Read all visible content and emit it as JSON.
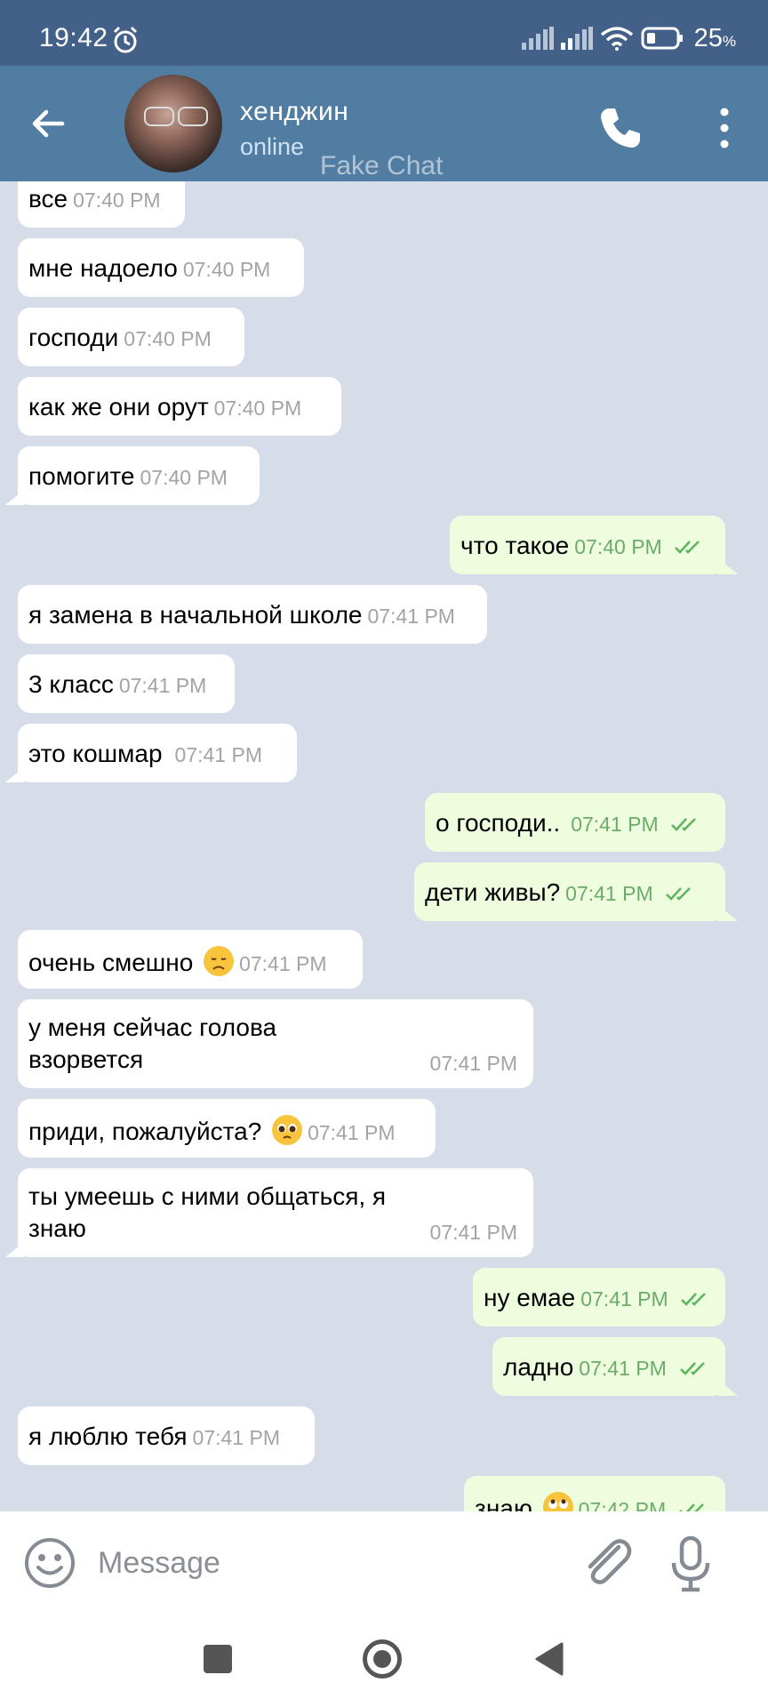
{
  "status_bar": {
    "time": "19:42",
    "battery": "25",
    "battery_unit": "%"
  },
  "header": {
    "contact_name": "хенджин",
    "contact_status": "online",
    "watermark": "Fake Chat"
  },
  "messages": [
    {
      "text": "все",
      "time": "07:40 PM",
      "direction": "in"
    },
    {
      "text": "мне надоело",
      "time": "07:40 PM",
      "direction": "in"
    },
    {
      "text": "господи",
      "time": "07:40 PM",
      "direction": "in"
    },
    {
      "text": "как же они орут",
      "time": "07:40 PM",
      "direction": "in"
    },
    {
      "text": "помогите",
      "time": "07:40 PM",
      "direction": "in"
    },
    {
      "text": "что такое",
      "time": "07:40 PM",
      "direction": "out"
    },
    {
      "text": "я замена в начальной школе",
      "time": "07:41 PM",
      "direction": "in"
    },
    {
      "text": "3 класс",
      "time": "07:41 PM",
      "direction": "in"
    },
    {
      "text": "это кошмар",
      "time": "07:41 PM",
      "direction": "in"
    },
    {
      "text": "о господи..",
      "time": "07:41 PM",
      "direction": "out"
    },
    {
      "text": "дети живы?",
      "time": "07:41 PM",
      "direction": "out"
    },
    {
      "text": "очень смешно",
      "emoji": "disappointed-face",
      "time": "07:41 PM",
      "direction": "in"
    },
    {
      "text": "у меня сейчас голова взорвется",
      "time": "07:41 PM",
      "direction": "in"
    },
    {
      "text": "приди, пожалуйста?",
      "emoji": "pleading-face",
      "time": "07:41 PM",
      "direction": "in"
    },
    {
      "text": "ты умеешь с ними общаться, я знаю",
      "time": "07:41 PM",
      "direction": "in"
    },
    {
      "text": "ну емае",
      "time": "07:41 PM",
      "direction": "out"
    },
    {
      "text": "ладно",
      "time": "07:41 PM",
      "direction": "out"
    },
    {
      "text": "я люблю тебя",
      "time": "07:41 PM",
      "direction": "in"
    },
    {
      "text": "знаю",
      "emoji": "eye-roll-face",
      "time": "07:42 PM",
      "direction": "out"
    }
  ],
  "input": {
    "placeholder": "Message",
    "value": ""
  },
  "colors": {
    "status_bar": "#436088",
    "header": "#527da3",
    "chat_background": "#d6dde8",
    "incoming_bubble": "#ffffff",
    "outgoing_bubble": "#effddf",
    "read_ticks": "#5fb55d"
  },
  "icons": {
    "alarm": "alarm-clock-icon",
    "back": "arrow-left-icon",
    "call": "phone-icon",
    "menu": "more-vertical-icon",
    "emoji": "smiley-icon",
    "attach": "paperclip-icon",
    "mic": "microphone-icon"
  }
}
